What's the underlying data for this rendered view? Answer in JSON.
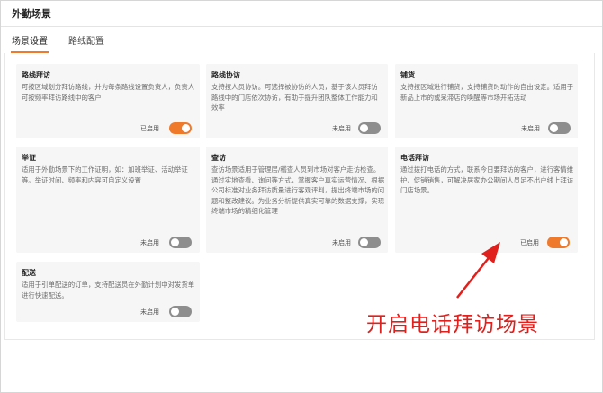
{
  "window": {
    "title": "外勤场景"
  },
  "tabs": [
    {
      "label": "场景设置",
      "active": true
    },
    {
      "label": "路线配置",
      "active": false
    }
  ],
  "cards": [
    {
      "title": "路线拜访",
      "desc": "可按区域划分拜访路线，并为每条路线设置负责人，负责人可按频率拜访路线中的客户",
      "status": "已启用",
      "enabled": true
    },
    {
      "title": "路线协访",
      "desc": "支持按人员协访。可选择被协访的人员，基于该人员拜访路线中的门店依次协访，有助于提升团队整体工作能力和效率",
      "status": "未启用",
      "enabled": false
    },
    {
      "title": "铺货",
      "desc": "支持按区域进行铺货，支持铺货时动作的自由设定。适用于新品上市的或呆滞店的唤醒等市场开拓活动",
      "status": "未启用",
      "enabled": false
    },
    {
      "title": "举证",
      "desc": "适用于外勤场景下的工作证明，如：加班举证、活动举证等。举证时间、频率和内容可自定义设置",
      "status": "未启用",
      "enabled": false
    },
    {
      "title": "查访",
      "desc": "查访场景适用于管理层/稽查人员到市场对客户走访检查。通过实地查看、询问等方式，掌握客户真实运营情况、根据公司标准对业务拜访质量进行客观评判，提出终端市场的问题和整改建议。为业务分析提供真实可靠的数据支撑，实现终端市场的精细化管理",
      "status": "未启用",
      "enabled": false
    },
    {
      "title": "电话拜访",
      "desc": "通过拨打电话的方式，联系今日要拜访的客户，进行客情维护、促销销售，可解决居家办公期间人员足不出户线上拜访门店场景。",
      "status": "已启用",
      "enabled": true
    },
    {
      "title": "配送",
      "desc": "适用于引单配送的订单，支持配送员在外勤计划中对发货单进行快速配送。",
      "status": "未启用",
      "enabled": false
    }
  ],
  "annotation": {
    "text": "开启电话拜访场景"
  },
  "colors": {
    "accent": "#f07a2c",
    "toggle_off": "#8e8e8e",
    "annotation": "#e0201c"
  }
}
